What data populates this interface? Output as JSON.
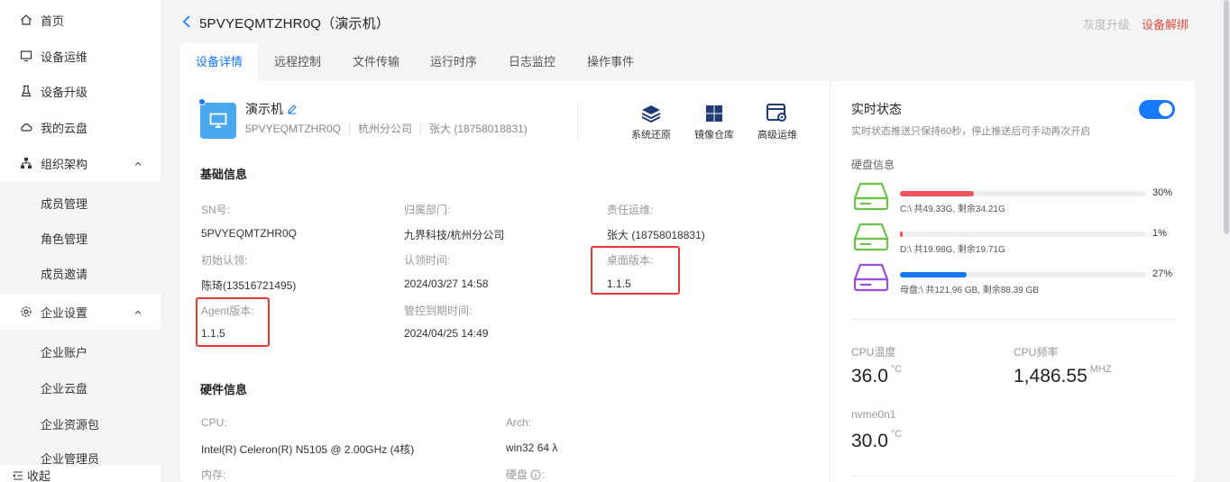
{
  "sidebar": {
    "items": [
      {
        "label": "首页",
        "icon": "home-icon"
      },
      {
        "label": "设备运维",
        "icon": "monitor-icon"
      },
      {
        "label": "设备升级",
        "icon": "flask-icon"
      },
      {
        "label": "我的云盘",
        "icon": "cloud-icon"
      },
      {
        "label": "组织架构",
        "icon": "org-icon"
      },
      {
        "label": "企业设置",
        "icon": "gear-icon"
      }
    ],
    "org_sub": [
      "成员管理",
      "角色管理",
      "成员邀请"
    ],
    "ent_sub": [
      "企业账户",
      "企业云盘",
      "企业资源包",
      "企业管理员"
    ],
    "collapse_label": "收起"
  },
  "header": {
    "title": "5PVYEQMTZHR0Q（演示机）",
    "gray_action": "灰度升级",
    "red_action": "设备解绑"
  },
  "tabs": [
    "设备详情",
    "远程控制",
    "文件传输",
    "运行时序",
    "日志监控",
    "操作事件"
  ],
  "device": {
    "name": "演示机",
    "sn": "5PVYEQMTZHR0Q",
    "branch": "杭州分公司",
    "owner": "张大 (18758018831)",
    "actions": [
      "系统还原",
      "镜像仓库",
      "高级运维"
    ]
  },
  "basic": {
    "title": "基础信息",
    "sn_label": "SN号:",
    "sn_value": "5PVYEQMTZHR0Q",
    "dept_label": "归属部门:",
    "dept_value": "九界科技/杭州分公司",
    "ops_label": "责任运维:",
    "ops_value": "张大 (18758018831)",
    "claim_label": "初始认领:",
    "claim_value": "陈琦(13516721495)",
    "claim_time_label": "认领时间:",
    "claim_time_value": "2024/03/27 14:58",
    "desktop_label": "桌面版本:",
    "desktop_value": "1.1.5",
    "agent_label": "Agent版本:",
    "agent_value": "1.1.5",
    "expire_label": "管控到期时间:",
    "expire_value": "2024/04/25 14:49"
  },
  "hardware": {
    "title": "硬件信息",
    "cpu_label": "CPU:",
    "cpu_value": "Intel(R) Celeron(R) N5105 @ 2.00GHz (4核)",
    "arch_label": "Arch:",
    "arch_value": "win32 64 λ",
    "mem_label": "内存:",
    "disk_label": "硬盘"
  },
  "realtime": {
    "title": "实时状态",
    "desc": "实时状态推送只保持60秒，停止推送后可手动再次开启",
    "disk_heading": "硬盘信息",
    "disks": [
      {
        "pct": 30,
        "pct_label": "30%",
        "info": "C:\\ 共49.33G, 剩余34.21G",
        "color": "#f0525a",
        "icon_color": "#6cc24a"
      },
      {
        "pct": 1,
        "pct_label": "1%",
        "info": "D:\\ 共19.98G, 剩余19.71G",
        "color": "#f0525a",
        "icon_color": "#6cc24a"
      },
      {
        "pct": 27,
        "pct_label": "27%",
        "info": "母盘:\\ 共121.96 GB, 剩余88.39 GB",
        "color": "#1677ff",
        "icon_color": "#9b4fd6"
      }
    ],
    "cpu_temp_label": "CPU温度",
    "cpu_temp_value": "36.0",
    "cpu_temp_unit": "°C",
    "cpu_freq_label": "CPU频率",
    "cpu_freq_value": "1,486.55",
    "cpu_freq_unit": "MHZ",
    "nvme_label": "nvme0n1",
    "nvme_value": "30.0",
    "nvme_unit": "°C"
  },
  "colors": {
    "accent": "#1677ff",
    "danger": "#e74c3c",
    "highlight_box": "#e53935"
  }
}
